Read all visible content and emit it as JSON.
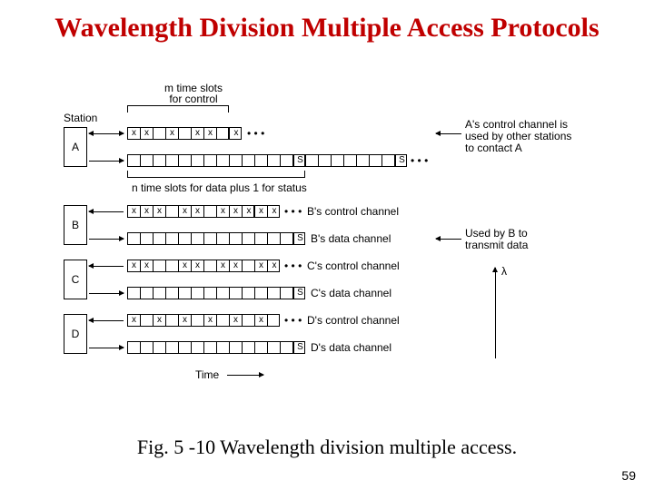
{
  "title": "Wavelength Division Multiple Access Protocols",
  "labels": {
    "station": "Station",
    "topControl1": "m time slots",
    "topControl2": "for control",
    "midData1": "n time slots for data plus 1 for status",
    "rightA1": "A's control channel is",
    "rightA2": "used by other stations",
    "rightA3": "to contact A",
    "rightB1": "Used by B to",
    "rightB2": "transmit data",
    "lambda": "λ",
    "time": "Time",
    "ellipsis": "• • •"
  },
  "stations": [
    "A",
    "B",
    "C",
    "D"
  ],
  "channelLabels": {
    "Bctrl": "B's control channel",
    "Bdata": "B's data channel",
    "Cctrl": "C's control channel",
    "Cdata": "C's data channel",
    "Dctrl": "D's control channel",
    "Ddata": "D's data channel"
  },
  "slotMark": "x",
  "statusMark": "S",
  "caption": "Fig. 5 -10 Wavelength division multiple access.",
  "page": "59"
}
